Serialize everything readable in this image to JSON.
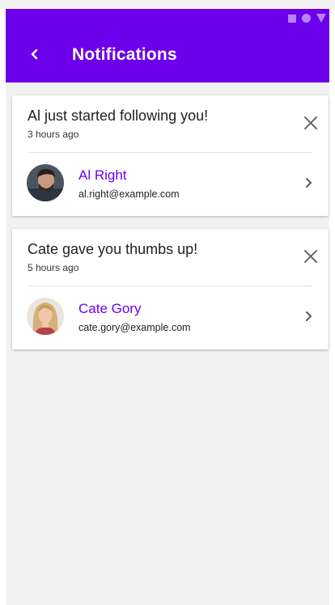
{
  "colors": {
    "appbar": "#6c00ea",
    "accent": "#6c00ea",
    "background": "#f2f2f2"
  },
  "appbar": {
    "title": "Notifications",
    "back_icon": "chevron-left-icon"
  },
  "status_bar": {
    "icons": [
      "square-icon",
      "circle-icon",
      "triangle-icon"
    ]
  },
  "notifications": [
    {
      "title": "Al just started following you!",
      "time": "3 hours ago",
      "user": {
        "name": "Al Right",
        "email": "al.right@example.com"
      }
    },
    {
      "title": "Cate gave you thumbs up!",
      "time": "5 hours ago",
      "user": {
        "name": "Cate Gory",
        "email": "cate.gory@example.com"
      }
    }
  ]
}
